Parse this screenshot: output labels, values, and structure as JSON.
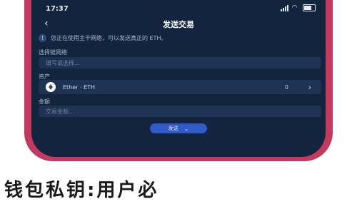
{
  "statusbar": {
    "time": "17:37"
  },
  "header": {
    "title": "发送交易",
    "back_icon": "chevron-left"
  },
  "notice": {
    "text": "您正在使用主干网络，可以发送真正的 ETH。"
  },
  "chain": {
    "label": "选择链网络",
    "placeholder": "填写或选择..."
  },
  "asset": {
    "label": "资产",
    "name": "Ether · ETH",
    "balance": "0"
  },
  "amount": {
    "label": "金额",
    "placeholder": "交易金额..."
  },
  "send_button": {
    "label": "发送"
  },
  "caption": {
    "text": "钱包私钥:用户必"
  },
  "colors": {
    "frame": "#c43a5e",
    "screen": "#13243f",
    "field": "#1e3354",
    "button": "#2f5ac7"
  }
}
